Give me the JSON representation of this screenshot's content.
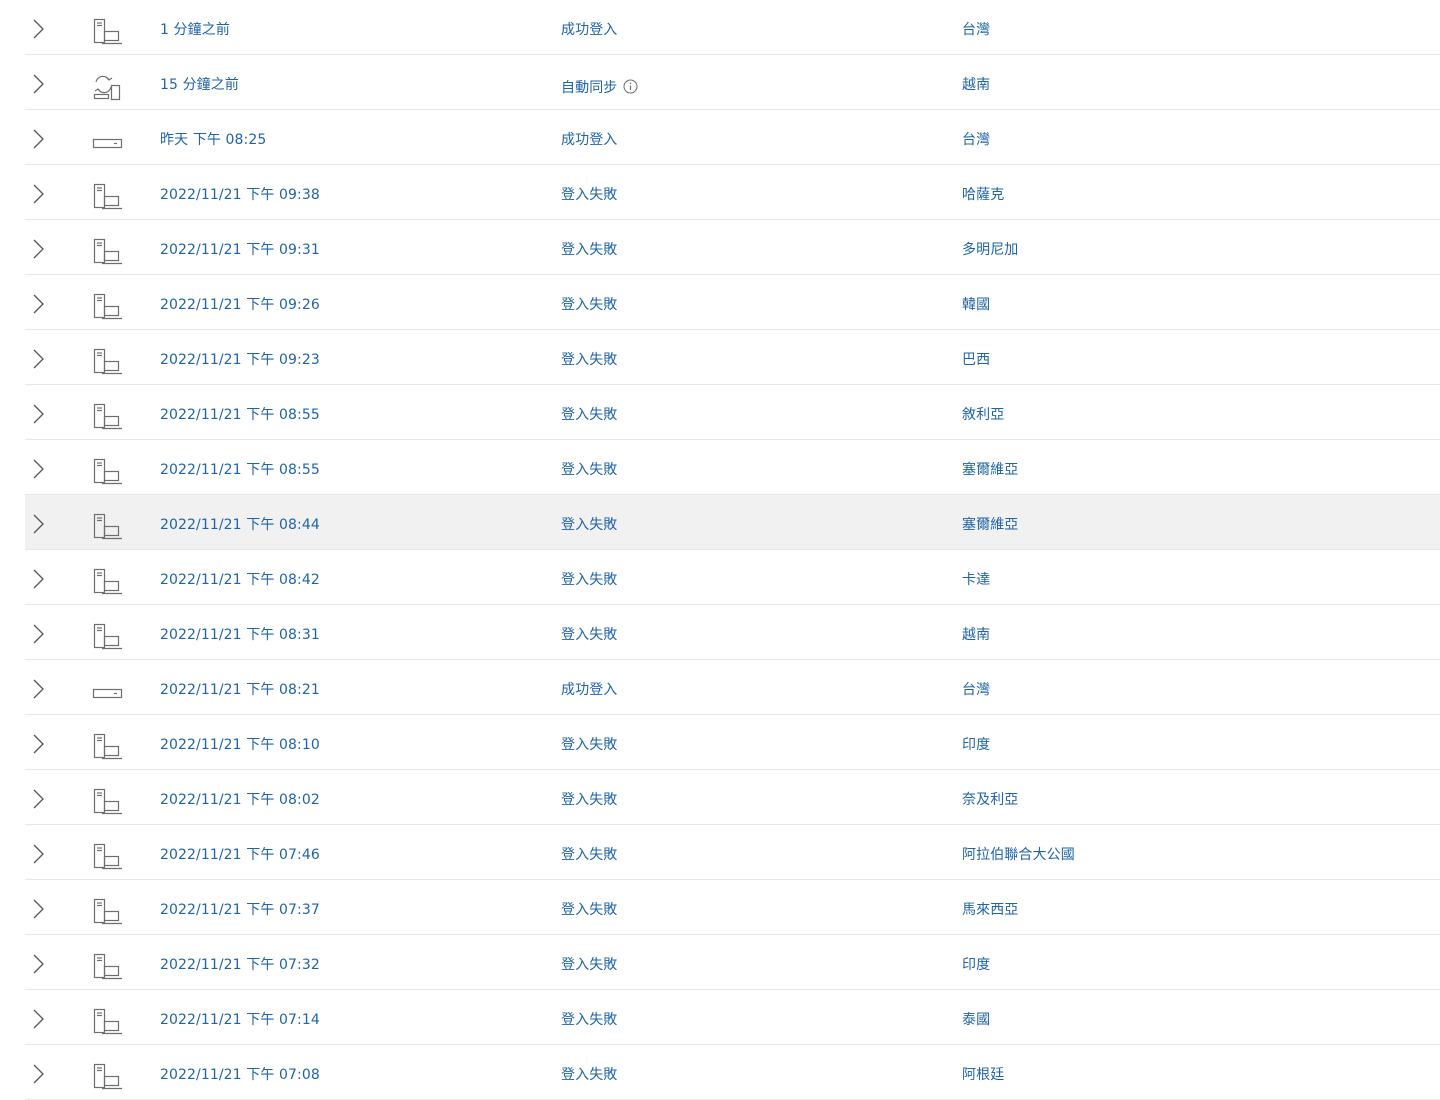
{
  "colors": {
    "link": "#1f63a8",
    "icon": "#6e6e6e",
    "divider": "#e8e8e8",
    "highlight": "#f1f1f1"
  },
  "rows": [
    {
      "time": "1 分鐘之前",
      "activity": "成功登入",
      "location": "台灣",
      "device": "desktop-laptop-icon"
    },
    {
      "time": "15 分鐘之前",
      "activity": "自動同步",
      "location": "越南",
      "device": "sync-device-icon",
      "info": true
    },
    {
      "time": "昨天 下午 08:25",
      "activity": "成功登入",
      "location": "台灣",
      "device": "server-icon"
    },
    {
      "time": "2022/11/21 下午 09:38",
      "activity": "登入失敗",
      "location": "哈薩克",
      "device": "desktop-laptop-icon"
    },
    {
      "time": "2022/11/21 下午 09:31",
      "activity": "登入失敗",
      "location": "多明尼加",
      "device": "desktop-laptop-icon"
    },
    {
      "time": "2022/11/21 下午 09:26",
      "activity": "登入失敗",
      "location": "韓國",
      "device": "desktop-laptop-icon"
    },
    {
      "time": "2022/11/21 下午 09:23",
      "activity": "登入失敗",
      "location": "巴西",
      "device": "desktop-laptop-icon"
    },
    {
      "time": "2022/11/21 下午 08:55",
      "activity": "登入失敗",
      "location": "敘利亞",
      "device": "desktop-laptop-icon"
    },
    {
      "time": "2022/11/21 下午 08:55",
      "activity": "登入失敗",
      "location": "塞爾維亞",
      "device": "desktop-laptop-icon"
    },
    {
      "time": "2022/11/21 下午 08:44",
      "activity": "登入失敗",
      "location": "塞爾維亞",
      "device": "desktop-laptop-icon",
      "highlight": true
    },
    {
      "time": "2022/11/21 下午 08:42",
      "activity": "登入失敗",
      "location": "卡達",
      "device": "desktop-laptop-icon"
    },
    {
      "time": "2022/11/21 下午 08:31",
      "activity": "登入失敗",
      "location": "越南",
      "device": "desktop-laptop-icon"
    },
    {
      "time": "2022/11/21 下午 08:21",
      "activity": "成功登入",
      "location": "台灣",
      "device": "server-icon"
    },
    {
      "time": "2022/11/21 下午 08:10",
      "activity": "登入失敗",
      "location": "印度",
      "device": "desktop-laptop-icon"
    },
    {
      "time": "2022/11/21 下午 08:02",
      "activity": "登入失敗",
      "location": "奈及利亞",
      "device": "desktop-laptop-icon"
    },
    {
      "time": "2022/11/21 下午 07:46",
      "activity": "登入失敗",
      "location": "阿拉伯聯合大公國",
      "device": "desktop-laptop-icon"
    },
    {
      "time": "2022/11/21 下午 07:37",
      "activity": "登入失敗",
      "location": "馬來西亞",
      "device": "desktop-laptop-icon"
    },
    {
      "time": "2022/11/21 下午 07:32",
      "activity": "登入失敗",
      "location": "印度",
      "device": "desktop-laptop-icon"
    },
    {
      "time": "2022/11/21 下午 07:14",
      "activity": "登入失敗",
      "location": "泰國",
      "device": "desktop-laptop-icon"
    },
    {
      "time": "2022/11/21 下午 07:08",
      "activity": "登入失敗",
      "location": "阿根廷",
      "device": "desktop-laptop-icon"
    }
  ]
}
